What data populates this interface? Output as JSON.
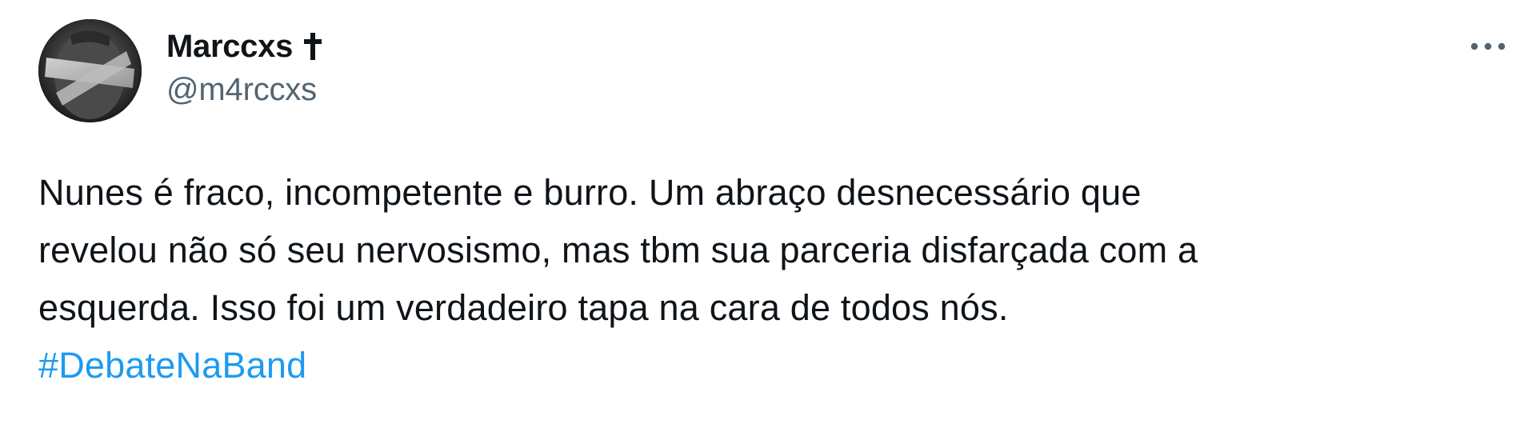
{
  "user": {
    "display_name": "Marccxs",
    "badge_icon": "latin-cross-icon",
    "handle": "@m4rccxs",
    "avatar_icon": "profile-avatar"
  },
  "menu": {
    "more_icon": "more-horizontal-icon"
  },
  "tweet": {
    "lines": [
      "Nunes é fraco, incompetente e burro. Um abraço desnecessário que",
      "revelou não só seu nervosismo, mas tbm sua parceria disfarçada com a",
      "esquerda. Isso foi um verdadeiro tapa na cara de todos nós."
    ],
    "hashtag": "#DebateNaBand"
  },
  "colors": {
    "text": "#0f1419",
    "secondary_text": "#536471",
    "link": "#1d9bf0",
    "background": "#ffffff"
  }
}
